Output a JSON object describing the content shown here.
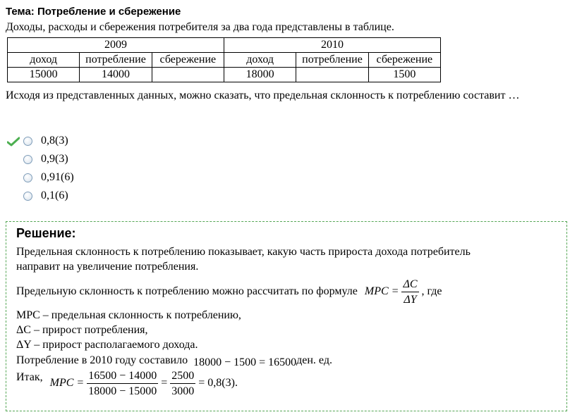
{
  "topic": "Тема: Потребление и сбережение",
  "intro": "Доходы, расходы и сбережения потребителя за два года представлены в таблице.",
  "table": {
    "years": [
      "2009",
      "2010"
    ],
    "columns": [
      "доход",
      "потребление",
      "сбережение",
      "доход",
      "потребление",
      "сбережение"
    ],
    "row": [
      "15000",
      "14000",
      "",
      "18000",
      "",
      "1500"
    ]
  },
  "question": "Исходя из представленных данных, можно сказать, что предельная склонность к потреблению составит …",
  "options": [
    "0,8(3)",
    "0,9(3)",
    "0,91(6)",
    "0,1(6)"
  ],
  "correct_icon": "check-icon",
  "solution": {
    "title": "Решение:",
    "p1_line1": "Предельная склонность к потреблению показывает, какую часть прироста дохода потребитель",
    "p1_line2": "направит на увеличение потребления.",
    "p2": "Предельную склонность к потреблению можно рассчитать по формуле",
    "p2_tail": ", где",
    "formula_lhs": "MPC =",
    "formula_num": "ΔC",
    "formula_den": "ΔY",
    "def1": "MPC – предельная склонность к потреблению,",
    "def2": "ΔC – прирост потребления,",
    "def3": "ΔY – прирост располагаемого дохода.",
    "calc_text": "Потребление в 2010 году составило",
    "calc_expr": "18000 − 1500 = 16500",
    "calc_unit": "ден. ед.",
    "final_label": "Итак,",
    "final_lhs": "MPC =",
    "final_num1": "16500 − 14000",
    "final_den1": "18000 − 15000",
    "final_eq": "=",
    "final_num2": "2500",
    "final_den2": "3000",
    "final_result": "= 0,8(3)."
  }
}
